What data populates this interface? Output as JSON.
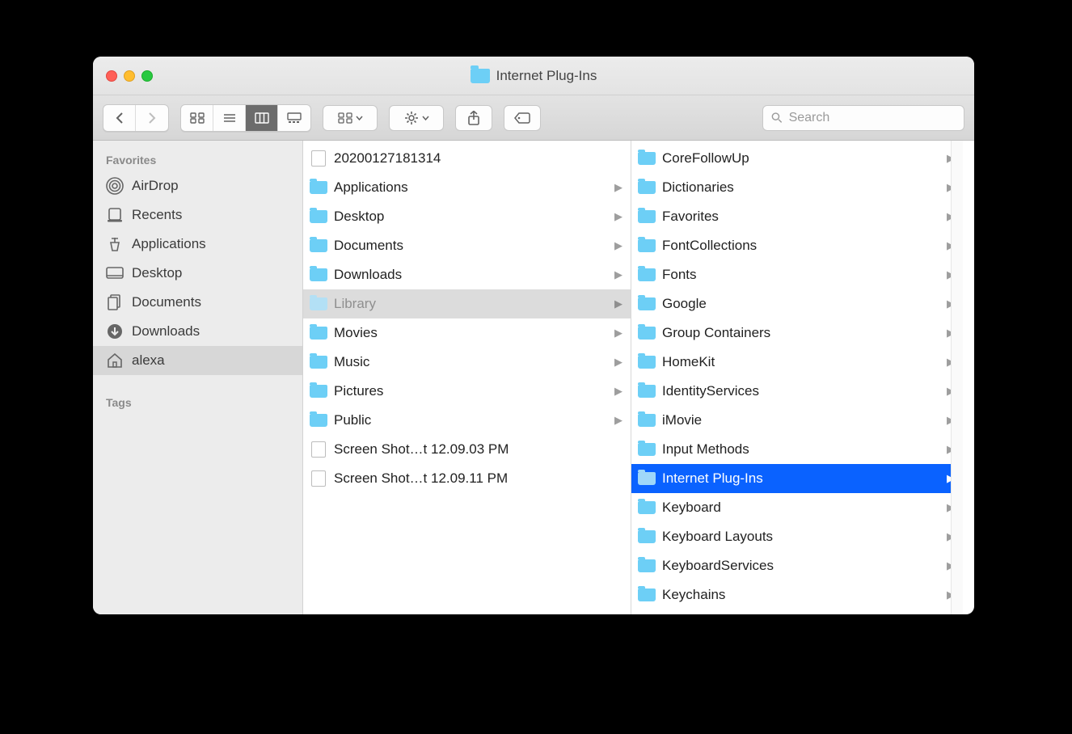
{
  "window": {
    "title": "Internet Plug-Ins"
  },
  "search": {
    "placeholder": "Search"
  },
  "sidebar": {
    "heading_favorites": "Favorites",
    "heading_tags": "Tags",
    "items": [
      {
        "label": "AirDrop",
        "icon": "airdrop"
      },
      {
        "label": "Recents",
        "icon": "recents"
      },
      {
        "label": "Applications",
        "icon": "applications"
      },
      {
        "label": "Desktop",
        "icon": "desktop"
      },
      {
        "label": "Documents",
        "icon": "documents"
      },
      {
        "label": "Downloads",
        "icon": "downloads"
      },
      {
        "label": "alexa",
        "icon": "home",
        "selected": true
      }
    ]
  },
  "columns": [
    {
      "items": [
        {
          "label": "20200127181314",
          "type": "file"
        },
        {
          "label": "Applications",
          "type": "folder"
        },
        {
          "label": "Desktop",
          "type": "folder"
        },
        {
          "label": "Documents",
          "type": "folder"
        },
        {
          "label": "Downloads",
          "type": "folder"
        },
        {
          "label": "Library",
          "type": "folder",
          "selected": "grey"
        },
        {
          "label": "Movies",
          "type": "folder"
        },
        {
          "label": "Music",
          "type": "folder"
        },
        {
          "label": "Pictures",
          "type": "folder"
        },
        {
          "label": "Public",
          "type": "folder"
        },
        {
          "label": "Screen Shot…t 12.09.03 PM",
          "type": "file"
        },
        {
          "label": "Screen Shot…t 12.09.11 PM",
          "type": "file"
        }
      ]
    },
    {
      "items": [
        {
          "label": "CoreFollowUp",
          "type": "folder"
        },
        {
          "label": "Dictionaries",
          "type": "folder"
        },
        {
          "label": "Favorites",
          "type": "folder"
        },
        {
          "label": "FontCollections",
          "type": "folder"
        },
        {
          "label": "Fonts",
          "type": "folder"
        },
        {
          "label": "Google",
          "type": "folder"
        },
        {
          "label": "Group Containers",
          "type": "folder"
        },
        {
          "label": "HomeKit",
          "type": "folder"
        },
        {
          "label": "IdentityServices",
          "type": "folder"
        },
        {
          "label": "iMovie",
          "type": "folder"
        },
        {
          "label": "Input Methods",
          "type": "folder"
        },
        {
          "label": "Internet Plug-Ins",
          "type": "folder",
          "selected": "blue"
        },
        {
          "label": "Keyboard",
          "type": "folder"
        },
        {
          "label": "Keyboard Layouts",
          "type": "folder"
        },
        {
          "label": "KeyboardServices",
          "type": "folder"
        },
        {
          "label": "Keychains",
          "type": "folder"
        }
      ]
    }
  ]
}
